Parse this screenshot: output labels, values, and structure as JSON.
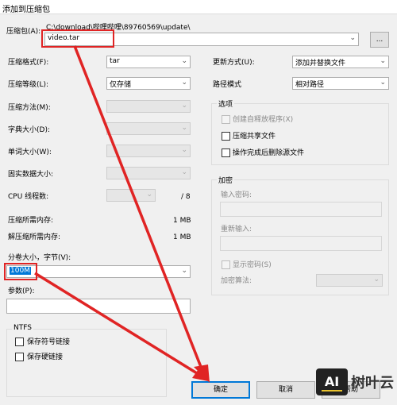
{
  "window": {
    "title": "添加到压缩包"
  },
  "archive": {
    "label": "压缩包(A):",
    "path": "C:\\download\\哔哩哔哩\\89760569\\update\\",
    "name": "video.tar",
    "browse_label": "..."
  },
  "left": {
    "format_label": "压缩格式(F):",
    "format_value": "tar",
    "level_label": "压缩等级(L):",
    "level_value": "仅存储",
    "method_label": "压缩方法(M):",
    "dict_label": "字典大小(D):",
    "word_label": "单词大小(W):",
    "solid_label": "固实数据大小:",
    "threads_label": "CPU 线程数:",
    "threads_total": "/ 8",
    "mem_compress_label": "压缩所需内存:",
    "mem_compress_value": "1 MB",
    "mem_decompress_label": "解压缩所需内存:",
    "mem_decompress_value": "1 MB",
    "split_label": "分卷大小，字节(V):",
    "split_value": "100M",
    "params_label": "参数(P):"
  },
  "right": {
    "update_label": "更新方式(U):",
    "update_value": "添加并替换文件",
    "path_mode_label": "路径模式",
    "path_mode_value": "相对路径",
    "options_title": "选项",
    "opt_sfx": "创建自释放程序(X)",
    "opt_shared": "压缩共享文件",
    "opt_delete": "操作完成后删除源文件",
    "encrypt_title": "加密",
    "pwd_label": "输入密码:",
    "pwd_again_label": "重新输入:",
    "show_pwd": "显示密码(S)",
    "enc_method_label": "加密算法:"
  },
  "ntfs": {
    "title": "NTFS",
    "symlinks": "保存符号链接",
    "hardlinks": "保存硬链接"
  },
  "buttons": {
    "ok": "确定",
    "cancel": "取消",
    "help": "帮助"
  },
  "watermark": {
    "logo": "AI",
    "text": "树叶云"
  },
  "colors": {
    "annotation": "#e02424",
    "accent": "#0078d7"
  }
}
